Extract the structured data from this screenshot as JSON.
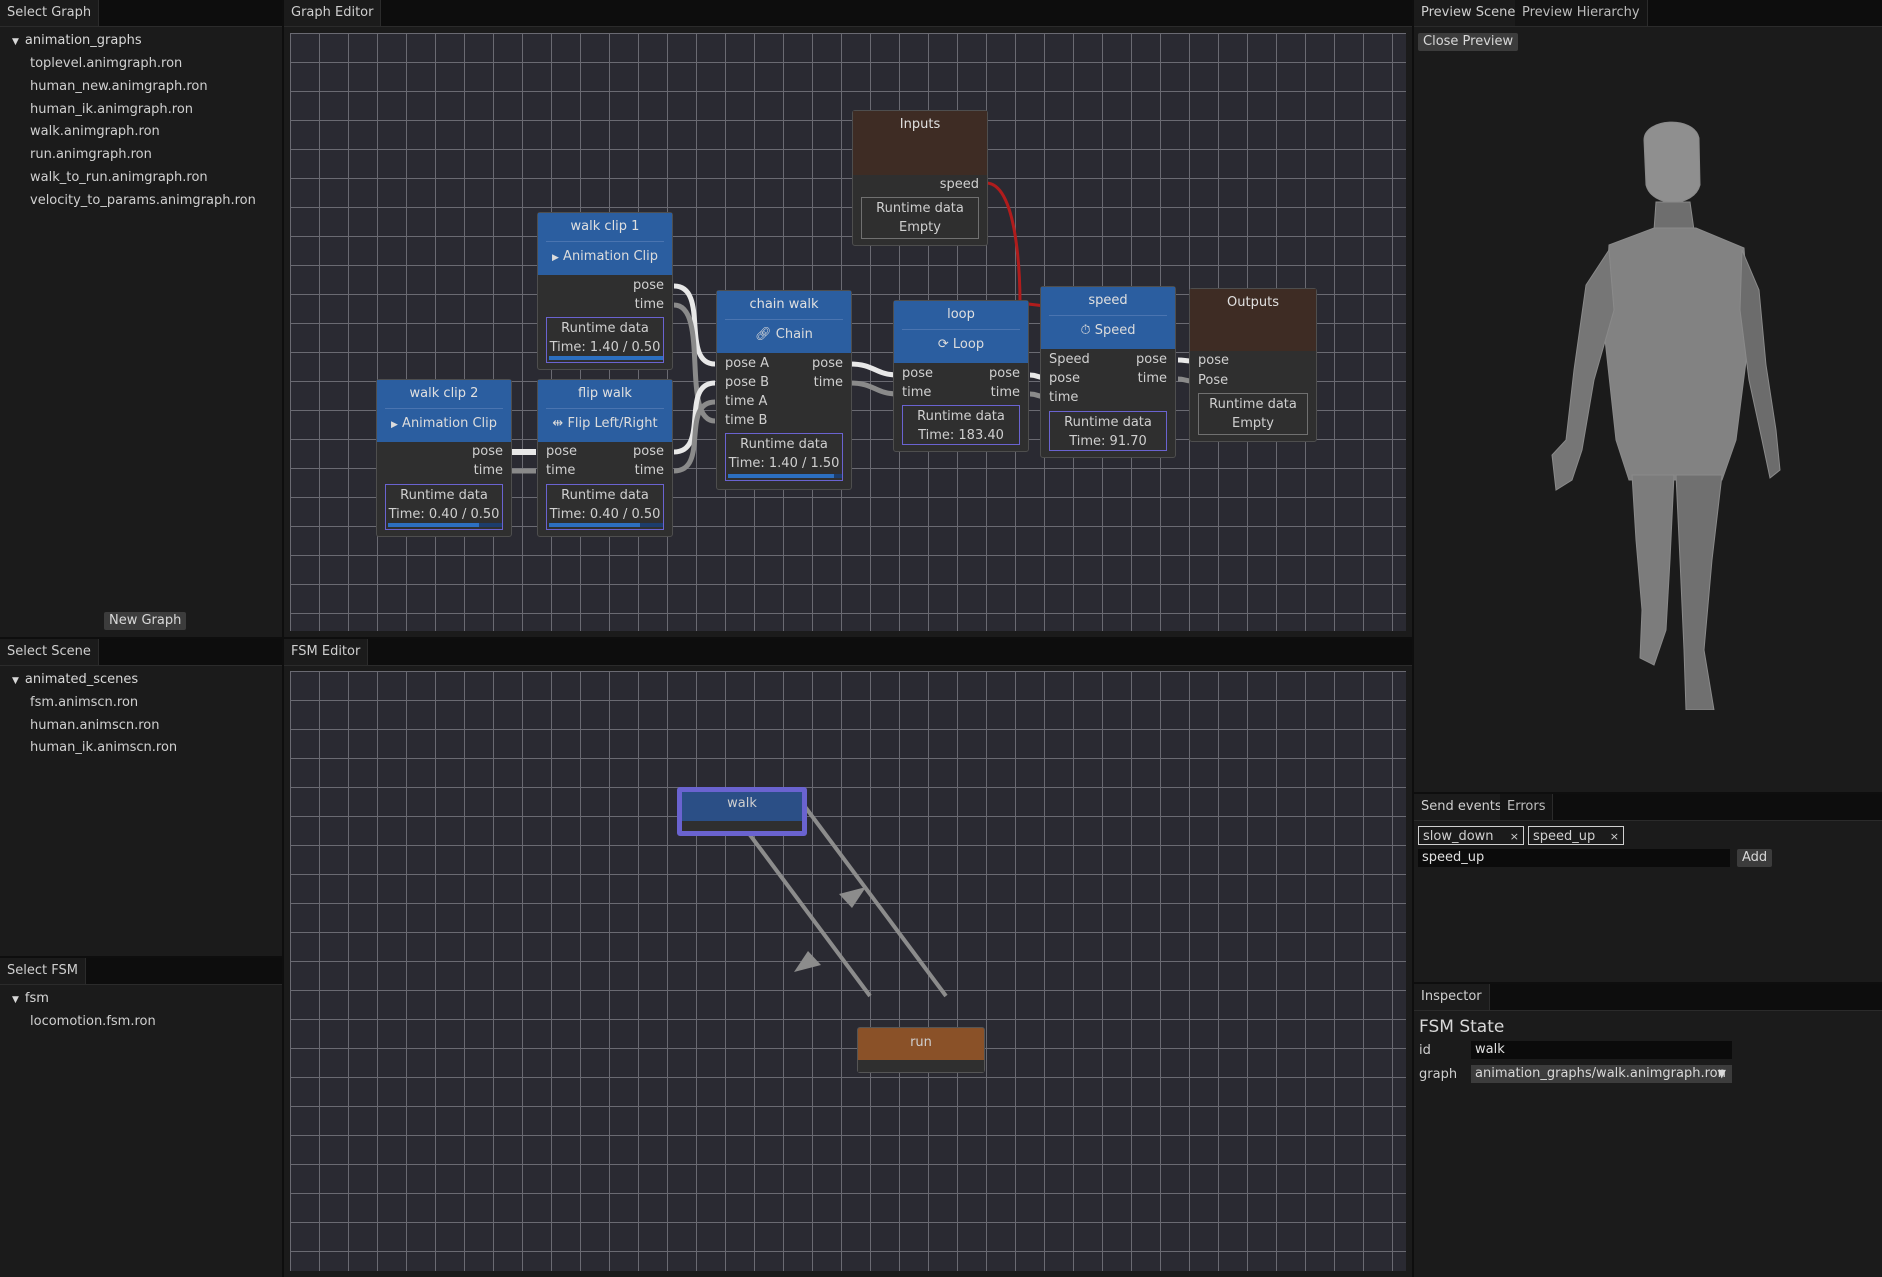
{
  "select_graph": {
    "tab": "Select Graph",
    "root": "animation_graphs",
    "items": [
      "toplevel.animgraph.ron",
      "human_new.animgraph.ron",
      "human_ik.animgraph.ron",
      "walk.animgraph.ron",
      "run.animgraph.ron",
      "walk_to_run.animgraph.ron",
      "velocity_to_params.animgraph.ron"
    ],
    "new_graph_button": "New Graph"
  },
  "select_scene": {
    "tab": "Select Scene",
    "root": "animated_scenes",
    "items": [
      "fsm.animscn.ron",
      "human.animscn.ron",
      "human_ik.animscn.ron"
    ]
  },
  "select_fsm": {
    "tab": "Select FSM",
    "root": "fsm",
    "items": [
      "locomotion.fsm.ron"
    ]
  },
  "graph_editor": {
    "tab": "Graph Editor",
    "nodes": {
      "inputs": {
        "title": "Inputs",
        "out_speed": "speed",
        "rt_title": "Runtime data",
        "rt_value": "Empty"
      },
      "walk_clip_1": {
        "title": "walk clip 1",
        "type": "Animation Clip",
        "out_pose": "pose",
        "out_time": "time",
        "rt_title": "Runtime data",
        "rt_value": "Time: 1.40 / 0.50",
        "progress": 1.0
      },
      "walk_clip_2": {
        "title": "walk clip 2",
        "type": "Animation Clip",
        "out_pose": "pose",
        "out_time": "time",
        "rt_title": "Runtime data",
        "rt_value": "Time: 0.40 / 0.50",
        "progress": 0.8
      },
      "flip_walk": {
        "title": "flip walk",
        "type": "Flip Left/Right",
        "in_pose": "pose",
        "in_time": "time",
        "out_pose": "pose",
        "out_time": "time",
        "rt_title": "Runtime data",
        "rt_value": "Time: 0.40 / 0.50",
        "progress": 0.8
      },
      "chain_walk": {
        "title": "chain walk",
        "type": "Chain",
        "in_pose_a": "pose A",
        "in_pose_b": "pose B",
        "in_time_a": "time A",
        "in_time_b": "time B",
        "out_pose": "pose",
        "out_time": "time",
        "rt_title": "Runtime data",
        "rt_value": "Time: 1.40 / 1.50",
        "progress": 0.93
      },
      "loop": {
        "title": "loop",
        "type": "Loop",
        "in_pose": "pose",
        "in_time": "time",
        "out_pose": "pose",
        "out_time": "time",
        "rt_title": "Runtime data",
        "rt_value": "Time: 183.40"
      },
      "speed": {
        "title": "speed",
        "type": "Speed",
        "in_speed": "Speed",
        "in_pose": "pose",
        "in_time": "time",
        "out_pose": "pose",
        "out_time": "time",
        "rt_title": "Runtime data",
        "rt_value": "Time: 91.70"
      },
      "outputs": {
        "title": "Outputs",
        "in_pose": "pose",
        "in_Pose": "Pose",
        "rt_title": "Runtime data",
        "rt_value": "Empty"
      }
    }
  },
  "fsm_editor": {
    "tab": "FSM Editor",
    "states": {
      "walk": "walk",
      "run": "run"
    }
  },
  "preview": {
    "tabs": [
      "Preview Scene",
      "Preview Hierarchy"
    ],
    "close_button": "Close Preview"
  },
  "send_events": {
    "tabs": [
      "Send events",
      "Errors"
    ],
    "events": [
      "slow_down",
      "speed_up"
    ],
    "input_value": "speed_up",
    "add_button": "Add",
    "remove_glyph": "×"
  },
  "inspector": {
    "tab": "Inspector",
    "heading": "FSM State",
    "id_label": "id",
    "id_value": "walk",
    "graph_label": "graph",
    "graph_value": "animation_graphs/walk.animgraph.ron"
  },
  "colors": {
    "node_header": "#2b5ea0",
    "io_header": "#3e2c24",
    "active_state_border": "#6a63d0",
    "run_state": "#8a5128",
    "speed_wire": "#b01c1c"
  }
}
